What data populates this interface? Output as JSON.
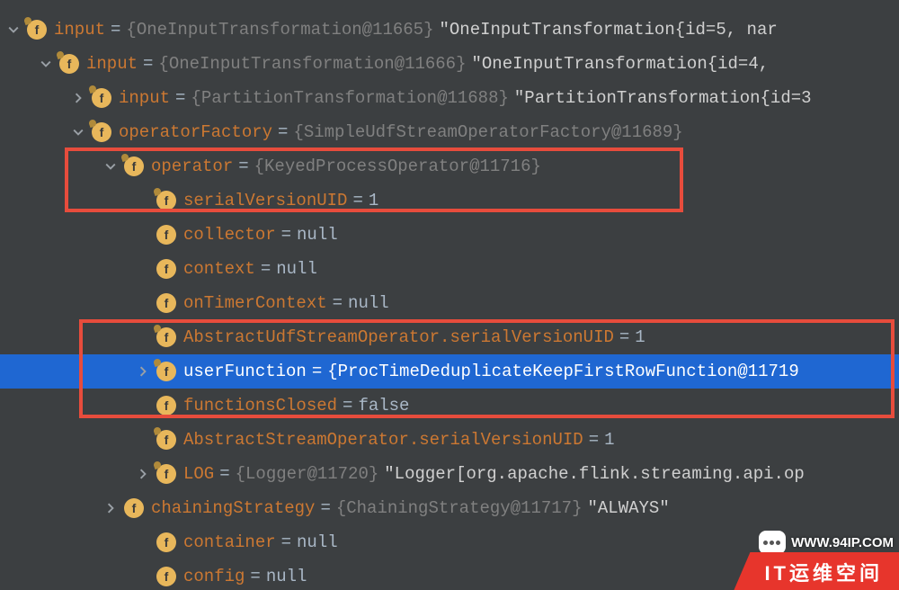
{
  "rows": [
    {
      "indent": 0,
      "arrow": "down",
      "pin": true,
      "name": "input",
      "type": "{OneInputTransformation@11665}",
      "str": "\"OneInputTransformation{id=5, nar",
      "selected": false
    },
    {
      "indent": 1,
      "arrow": "down",
      "pin": true,
      "name": "input",
      "type": "{OneInputTransformation@11666}",
      "str": "\"OneInputTransformation{id=4,",
      "selected": false
    },
    {
      "indent": 2,
      "arrow": "right",
      "pin": true,
      "name": "input",
      "type": "{PartitionTransformation@11688}",
      "str": "\"PartitionTransformation{id=3",
      "selected": false
    },
    {
      "indent": 2,
      "arrow": "down",
      "pin": true,
      "name": "operatorFactory",
      "type": "{SimpleUdfStreamOperatorFactory@11689}",
      "str": "",
      "selected": false
    },
    {
      "indent": 3,
      "arrow": "down",
      "pin": true,
      "name": "operator",
      "type": "{KeyedProcessOperator@11716}",
      "str": "",
      "selected": false
    },
    {
      "indent": 4,
      "arrow": "blank",
      "pin": true,
      "name": "serialVersionUID",
      "val": "1",
      "selected": false
    },
    {
      "indent": 4,
      "arrow": "blank",
      "pin": false,
      "name": "collector",
      "val": "null",
      "selected": false
    },
    {
      "indent": 4,
      "arrow": "blank",
      "pin": false,
      "name": "context",
      "val": "null",
      "selected": false
    },
    {
      "indent": 4,
      "arrow": "blank",
      "pin": false,
      "name": "onTimerContext",
      "val": "null",
      "selected": false
    },
    {
      "indent": 4,
      "arrow": "blank",
      "pin": true,
      "name": "AbstractUdfStreamOperator.serialVersionUID",
      "val": "1",
      "selected": false
    },
    {
      "indent": 4,
      "arrow": "right",
      "pin": true,
      "name": "userFunction",
      "type": "{ProcTimeDeduplicateKeepFirstRowFunction@11719",
      "str": "",
      "selected": true
    },
    {
      "indent": 4,
      "arrow": "blank",
      "pin": false,
      "name": "functionsClosed",
      "val": "false",
      "selected": false
    },
    {
      "indent": 4,
      "arrow": "blank",
      "pin": true,
      "name": "AbstractStreamOperator.serialVersionUID",
      "val": "1",
      "selected": false
    },
    {
      "indent": 4,
      "arrow": "right",
      "pin": true,
      "name": "LOG",
      "type": "{Logger@11720}",
      "str": "\"Logger[org.apache.flink.streaming.api.op",
      "selected": false
    },
    {
      "indent": 3,
      "arrow": "right",
      "pin": false,
      "name": "chainingStrategy",
      "type": "{ChainingStrategy@11717}",
      "str": "\"ALWAYS\"",
      "selected": false
    },
    {
      "indent": 4,
      "arrow": "blank",
      "pin": false,
      "name": "container",
      "val": "null",
      "selected": false
    },
    {
      "indent": 4,
      "arrow": "blank",
      "pin": false,
      "name": "config",
      "val": "null",
      "selected": false
    }
  ],
  "watermark": {
    "url": "WWW.94IP.COM",
    "banner": "IT运维空间"
  },
  "highlights": [
    {
      "class": "hl1"
    },
    {
      "class": "hl2"
    }
  ]
}
